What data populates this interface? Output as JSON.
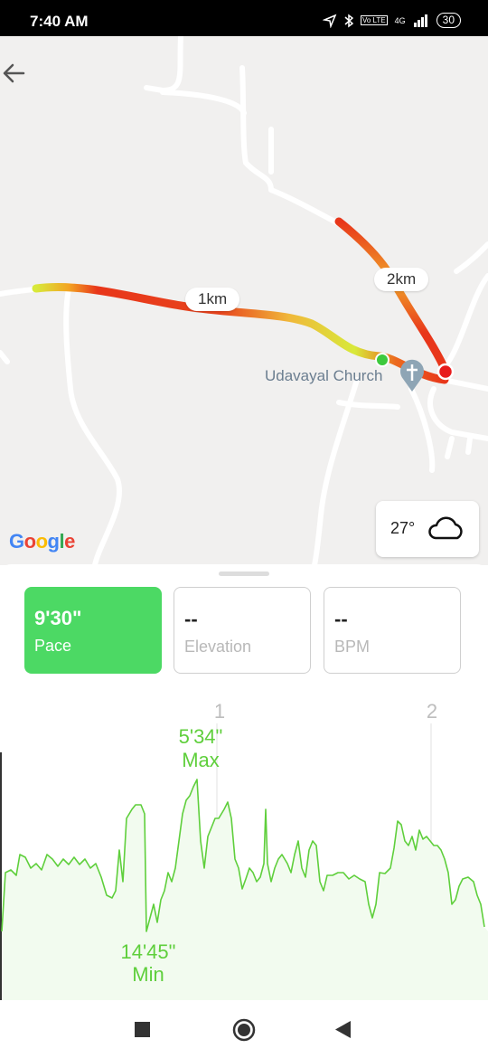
{
  "status_bar": {
    "time": "7:40 AM",
    "network": "4G",
    "volte": "Vo LTE",
    "battery": "30"
  },
  "map": {
    "distance_labels": [
      "1km",
      "2km"
    ],
    "poi_name": "Udavayal Church",
    "attribution": "Google",
    "weather": {
      "temperature": "27°",
      "condition_icon": "cloud-icon"
    }
  },
  "stats": [
    {
      "value": "9'30\"",
      "label": "Pace",
      "active": true
    },
    {
      "value": "--",
      "label": "Elevation",
      "active": false
    },
    {
      "value": "--",
      "label": "BPM",
      "active": false
    }
  ],
  "pace_chart": {
    "km_markers": [
      "1",
      "2"
    ],
    "max": {
      "value": "5'34\"",
      "label": "Max"
    },
    "min": {
      "value": "14'45\"",
      "label": "Min"
    },
    "line_color": "#5fcf3c"
  },
  "colors": {
    "accent": "#4cd964",
    "route_hot": "#e8361a",
    "route_warm": "#f7a21b",
    "route_cool": "#d8e93a"
  }
}
